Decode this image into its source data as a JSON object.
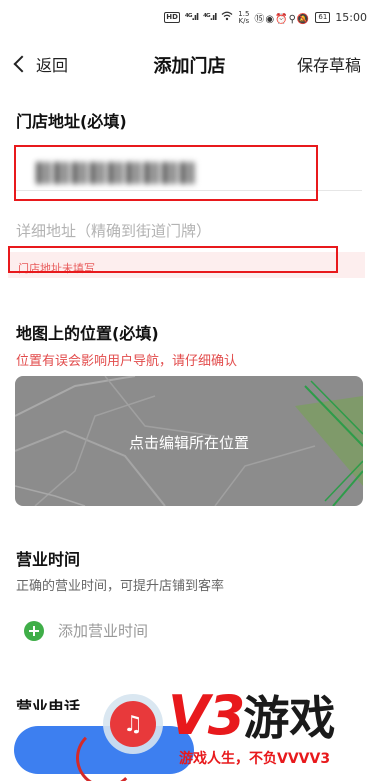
{
  "status_bar": {
    "hd_badge": "HD",
    "signal1": "⁴ᴳ.ıl",
    "signal2": "⁴ᴳ.ıl",
    "wifi_icon": "wifi-icon",
    "speed": "1.5",
    "speed_unit": "K/s",
    "icons": "⑮◉⏰⚲🔕",
    "battery": "61",
    "time": "15:00"
  },
  "nav": {
    "back_label": "返回",
    "title": "添加门店",
    "save_draft": "保存草稿"
  },
  "address": {
    "section_title": "门店地址(必填)",
    "detail_placeholder": "详细地址（精确到街道门牌）",
    "error": "门店地址未填写"
  },
  "map": {
    "section_title": "地图上的位置(必填)",
    "warning": "位置有误会影响用户导航，请仔细确认",
    "edit_label": "点击编辑所在位置"
  },
  "hours": {
    "section_title": "营业时间",
    "subtitle": "正确的营业时间，可提升店铺到客率",
    "add_label": "添加营业时间"
  },
  "phone": {
    "section_title": "营业电话"
  },
  "watermark": {
    "brand_v3": "V3",
    "brand_youxi": "游戏",
    "slogan": "游戏人生，不负VVVV3"
  },
  "colors": {
    "accent_red": "#e8191c",
    "button_blue": "#3d7ff0",
    "plus_green": "#3fae48",
    "map_gray": "#8c8c8c"
  }
}
